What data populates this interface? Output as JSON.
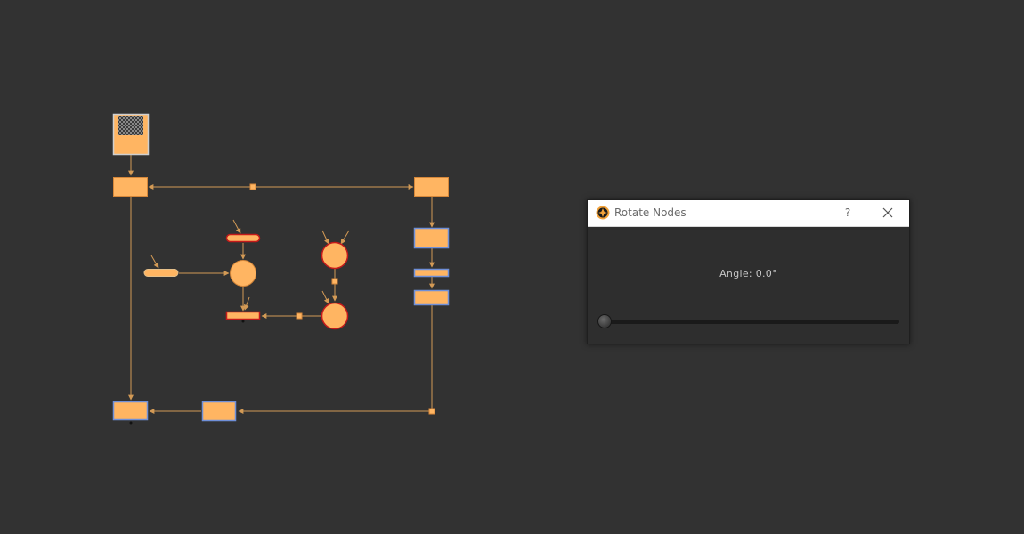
{
  "dialog": {
    "title": "Rotate Nodes",
    "help_label": "?",
    "angle_label": "Angle: 0.0°",
    "angle_value": 0.0,
    "slider": {
      "min": 0,
      "max": 360,
      "value": 0
    }
  },
  "colors": {
    "canvas_bg": "#323232",
    "node_fill": "#ffb562",
    "node_border_default": "#d5873a",
    "node_border_selected": "#5a7fd0",
    "node_border_red": "#c41a1a",
    "edge": "#d39a55"
  },
  "icons": {
    "app": "nuke-app-icon",
    "close": "close-icon",
    "help": "help-icon"
  }
}
